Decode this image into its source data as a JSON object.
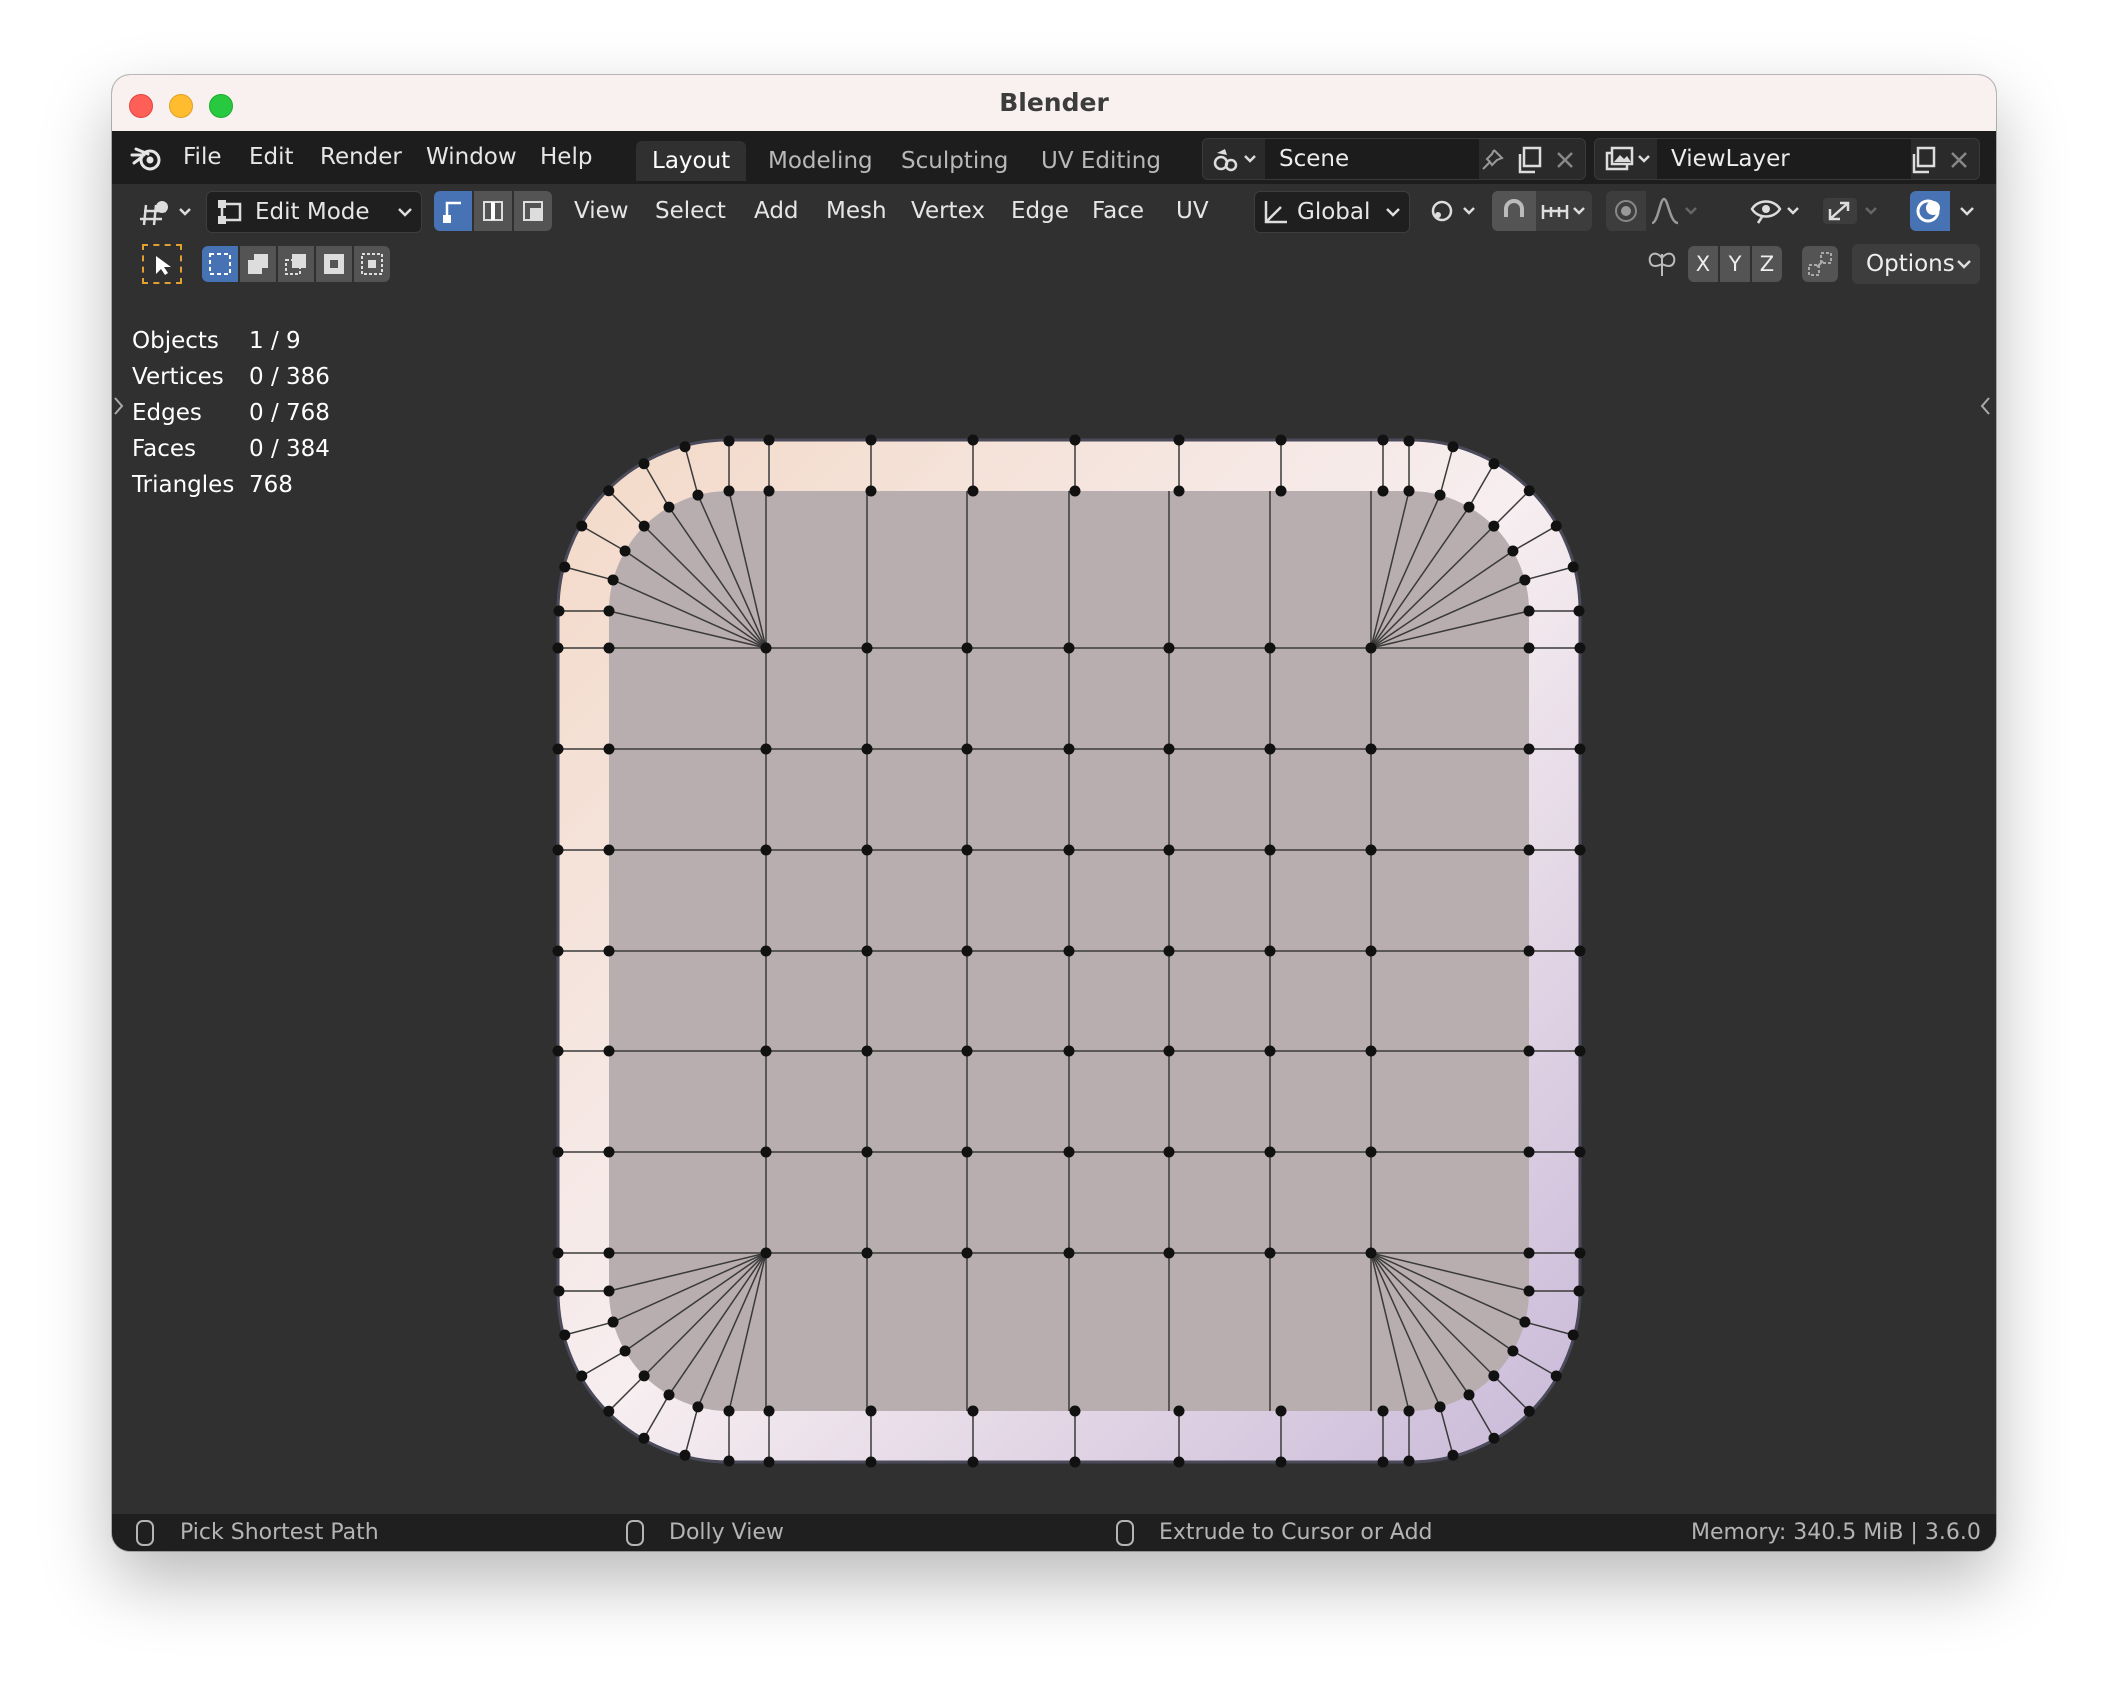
{
  "window": {
    "title": "Blender"
  },
  "topbar": {
    "menus": [
      "File",
      "Edit",
      "Render",
      "Window",
      "Help"
    ],
    "workspaces": [
      "Layout",
      "Modeling",
      "Sculpting",
      "UV Editing"
    ],
    "active_workspace": "Layout",
    "scene": "Scene",
    "view_layer": "ViewLayer"
  },
  "header": {
    "mode": "Edit Mode",
    "menus": [
      "View",
      "Select",
      "Add",
      "Mesh",
      "Vertex",
      "Edge",
      "Face",
      "UV"
    ],
    "transform_orientation": "Global"
  },
  "toolrow": {
    "axes": [
      "X",
      "Y",
      "Z"
    ],
    "options_label": "Options"
  },
  "stats": [
    {
      "label": "Objects",
      "value": "1 / 9"
    },
    {
      "label": "Vertices",
      "value": "0 / 386"
    },
    {
      "label": "Edges",
      "value": "0 / 768"
    },
    {
      "label": "Faces",
      "value": "0 / 384"
    },
    {
      "label": "Triangles",
      "value": "768"
    }
  ],
  "statusbar": {
    "left": "Pick Shortest Path",
    "middle": "Dolly View",
    "right_action": "Extrude to Cursor or Add",
    "memory": "Memory: 340.5 MiB | 3.6.0"
  },
  "colors": {
    "accent": "#4772b3",
    "mesh_face": "#b8aeaf",
    "active_tool_outline": "#e39f2f"
  }
}
